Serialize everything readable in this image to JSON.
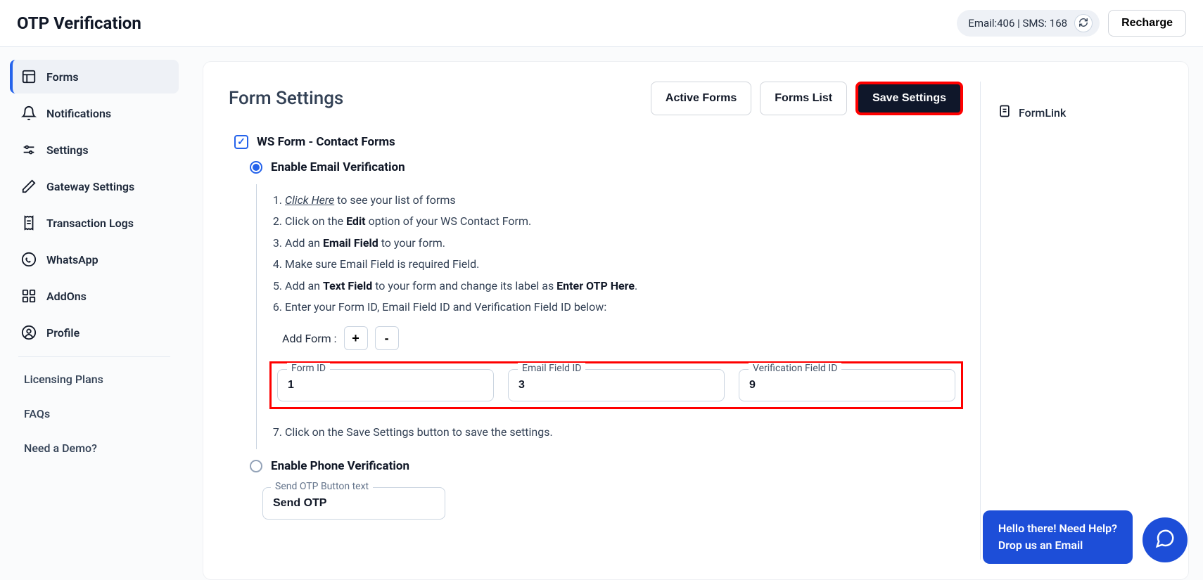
{
  "header": {
    "title": "OTP Verification",
    "credit_email_label": "Email:",
    "credit_email": "406",
    "credit_sep": " | ",
    "credit_sms_label": "SMS: ",
    "credit_sms": "168",
    "recharge": "Recharge"
  },
  "sidebar": {
    "items": [
      {
        "label": "Forms"
      },
      {
        "label": "Notifications"
      },
      {
        "label": "Settings"
      },
      {
        "label": "Gateway Settings"
      },
      {
        "label": "Transaction Logs"
      },
      {
        "label": "WhatsApp"
      },
      {
        "label": "AddOns"
      },
      {
        "label": "Profile"
      }
    ],
    "links": [
      {
        "label": "Licensing Plans"
      },
      {
        "label": "FAQs"
      },
      {
        "label": "Need a Demo?"
      }
    ]
  },
  "main": {
    "title": "Form Settings",
    "actions": {
      "active_forms": "Active Forms",
      "forms_list": "Forms List",
      "save_settings": "Save Settings"
    },
    "checkbox_label": "WS Form - Contact Forms",
    "radio_email": "Enable Email Verification",
    "radio_phone": "Enable Phone Verification",
    "steps": {
      "s1_a": "Click Here",
      "s1_b": " to see your list of forms",
      "s2_a": "Click on the ",
      "s2_b": "Edit",
      "s2_c": " option of your WS Contact Form.",
      "s3_a": "Add an ",
      "s3_b": "Email Field",
      "s3_c": " to your form.",
      "s4": "Make sure Email Field is required Field.",
      "s5_a": "Add an ",
      "s5_b": "Text Field",
      "s5_c": " to your form and change its label as ",
      "s5_d": "Enter OTP Here",
      "s5_e": ".",
      "s6": "Enter your Form ID, Email Field ID and Verification Field ID below:",
      "s7": "Click on the Save Settings button to save the settings."
    },
    "add_form_label": "Add Form :",
    "fields": {
      "form_id_label": "Form ID",
      "form_id_value": "1",
      "email_field_label": "Email Field ID",
      "email_field_value": "3",
      "verification_label": "Verification Field ID",
      "verification_value": "9"
    },
    "send_otp_label": "Send OTP Button text",
    "send_otp_value": "Send OTP"
  },
  "aside": {
    "formlink": "FormLink"
  },
  "help": {
    "line1": "Hello there! Need Help?",
    "line2": "Drop us an Email"
  }
}
